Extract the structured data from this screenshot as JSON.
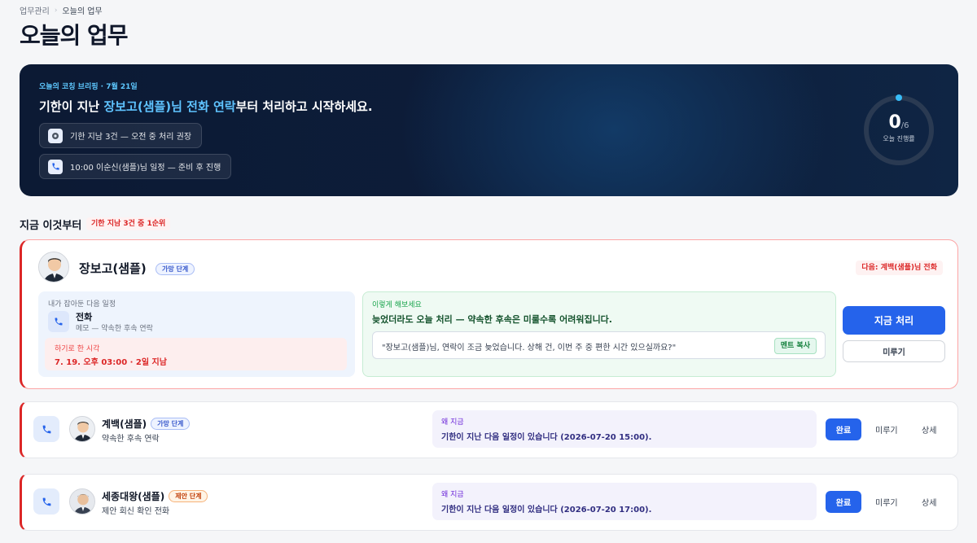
{
  "breadcrumb": {
    "parent": "업무관리",
    "separator": "›",
    "current": "오늘의 업무"
  },
  "page": {
    "title": "오늘의 업무"
  },
  "hero": {
    "eyebrow": "오늘의 코칭 브리핑 · 7월 21일",
    "headline_pre": "기한이 지난 ",
    "headline_highlight": "장보고(샘플)님 전화 연락",
    "headline_post": "부터 처리하고 시작하세요.",
    "chips": [
      {
        "icon": "alert-icon",
        "text": "기한 지남 3건 — 오전 중 처리 권장"
      },
      {
        "icon": "phone-icon",
        "text": "10:00 이순신(샘플)님 일정 — 준비 후 진행"
      }
    ],
    "progress": {
      "done": "0",
      "total": "/6",
      "label": "오늘 진행률",
      "fraction": 0
    }
  },
  "section": {
    "title": "지금 이것부터",
    "badge": "기한 지남 3건 중 1순위"
  },
  "focus_task": {
    "name": "장보고(샘플)",
    "stage": "가망 단계",
    "next_badge": "다음: 계백(샘플)님 전화",
    "schedule_caption": "내가 잡아둔 다음 일정",
    "schedule_type": "전화",
    "schedule_memo": "메모 — 약속한 후속 연락",
    "promised_caption": "하기로 한 시각",
    "promised_value": "7. 19. 오후 03:00 · 2일 지남",
    "tip_caption": "이렇게 해보세요",
    "tip_text": "늦었더라도 오늘 처리 — 약속한 후속은 미룰수록 어려워집니다.",
    "script_text": "\"장보고(샘플)님, 연락이 조금 늦었습니다. 상해 건, 이번 주 중 편한 시간 있으실까요?\"",
    "copy_label": "멘트 복사",
    "primary_label": "지금 처리",
    "secondary_label": "미루기"
  },
  "tasks": [
    {
      "name": "계백(샘플)",
      "stage": "가망 단계",
      "desc": "약속한 후속 연락",
      "why_caption": "왜 지금",
      "why_text": "기한이 지난 다음 일정이 있습니다 (2026-07-20 15:00).",
      "done_label": "완료",
      "postpone_label": "미루기",
      "detail_label": "상세"
    },
    {
      "name": "세종대왕(샘플)",
      "stage": "제안 단계",
      "desc": "제안 회신 확인 전화",
      "why_caption": "왜 지금",
      "why_text": "기한이 지난 다음 일정이 있습니다 (2026-07-20 17:00).",
      "done_label": "완료",
      "postpone_label": "미루기",
      "detail_label": "상세"
    }
  ],
  "colors": {
    "accent": "#2563eb",
    "danger": "#dc2626",
    "hero_bg": "#0c1a34",
    "highlight": "#5fc3ff"
  }
}
